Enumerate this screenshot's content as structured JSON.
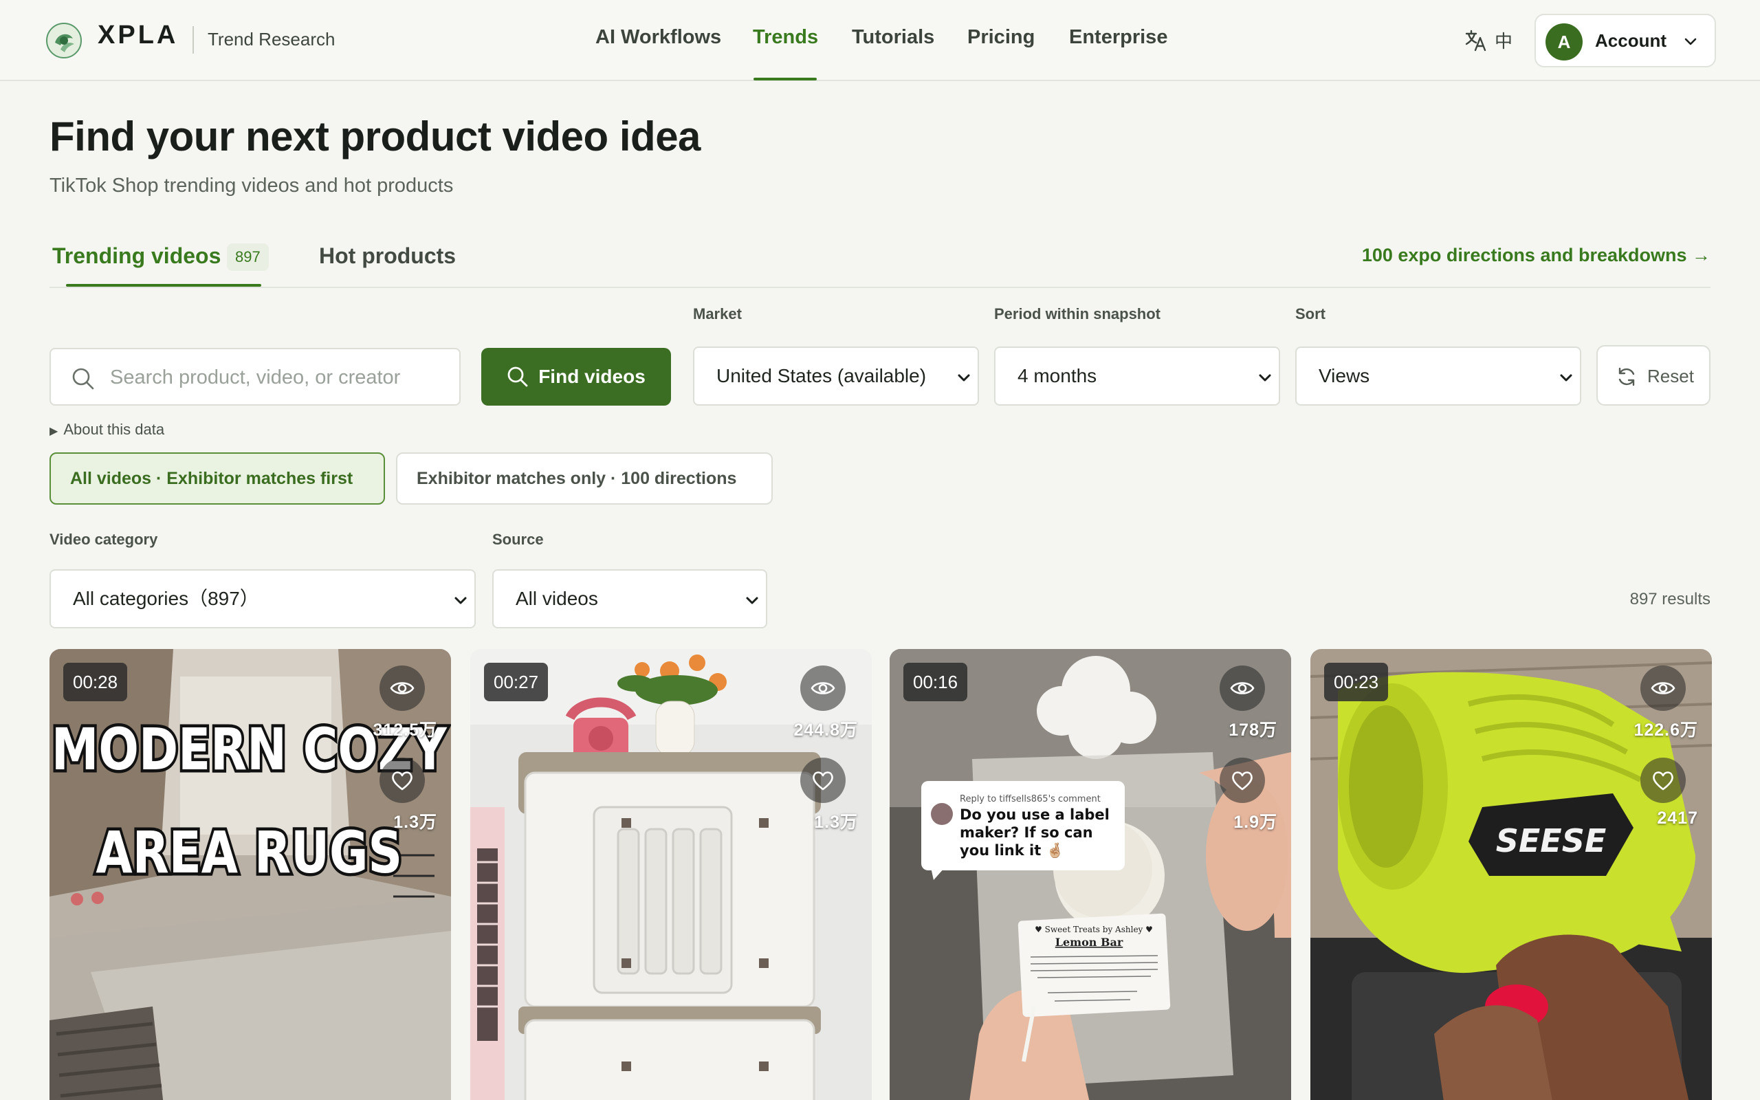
{
  "brand": {
    "name": "XPLA",
    "subtitle": "Trend Research"
  },
  "nav": {
    "items": [
      "AI Workflows",
      "Trends",
      "Tutorials",
      "Pricing",
      "Enterprise"
    ],
    "active": "Trends"
  },
  "lang": {
    "icon": "translate-icon",
    "label": "中"
  },
  "account": {
    "avatar": "A",
    "label": "Account"
  },
  "header": {
    "title": "Find your next product video idea",
    "subtitle": "TikTok Shop trending videos and hot products"
  },
  "tabs": {
    "trending": {
      "label": "Trending videos",
      "count": "897"
    },
    "hot": {
      "label": "Hot products"
    },
    "expo_link": "100 expo directions and breakdowns →"
  },
  "filters": {
    "search_placeholder": "Search product, video, or creator",
    "find_label": "Find videos",
    "market_label": "Market",
    "market_value": "United States (available)",
    "period_label": "Period within snapshot",
    "period_value": "4 months",
    "sort_label": "Sort",
    "sort_value": "Views",
    "reset_label": "Reset",
    "about": "About this data",
    "chip_all": "All videos · Exhibitor matches first",
    "chip_exhibitor": "Exhibitor matches only · 100 directions",
    "category_label": "Video category",
    "category_value": "All categories（897）",
    "source_label": "Source",
    "source_value": "All videos",
    "results": "897 results"
  },
  "cards": [
    {
      "duration": "00:28",
      "views": "312.5万",
      "likes": "1.3万",
      "overlay_line1": "MODERN COZY",
      "overlay_line2": "AREA RUGS"
    },
    {
      "duration": "00:27",
      "views": "244.8万",
      "likes": "1.3万"
    },
    {
      "duration": "00:16",
      "views": "178万",
      "likes": "1.9万",
      "comment_reply": "Reply to tiffsells865's comment",
      "comment_text": "Do you use a label maker? If so can you link it 🤞🏼",
      "label_brand": "♥ Sweet Treats by Ashley ♥",
      "label_product": "Lemon Bar"
    },
    {
      "duration": "00:23",
      "views": "122.6万",
      "likes": "2417",
      "product_brand": "SEESE"
    }
  ],
  "colors": {
    "accent": "#3a7a1f",
    "accent_dark": "#3b6e22",
    "background": "#f5f6f2"
  }
}
